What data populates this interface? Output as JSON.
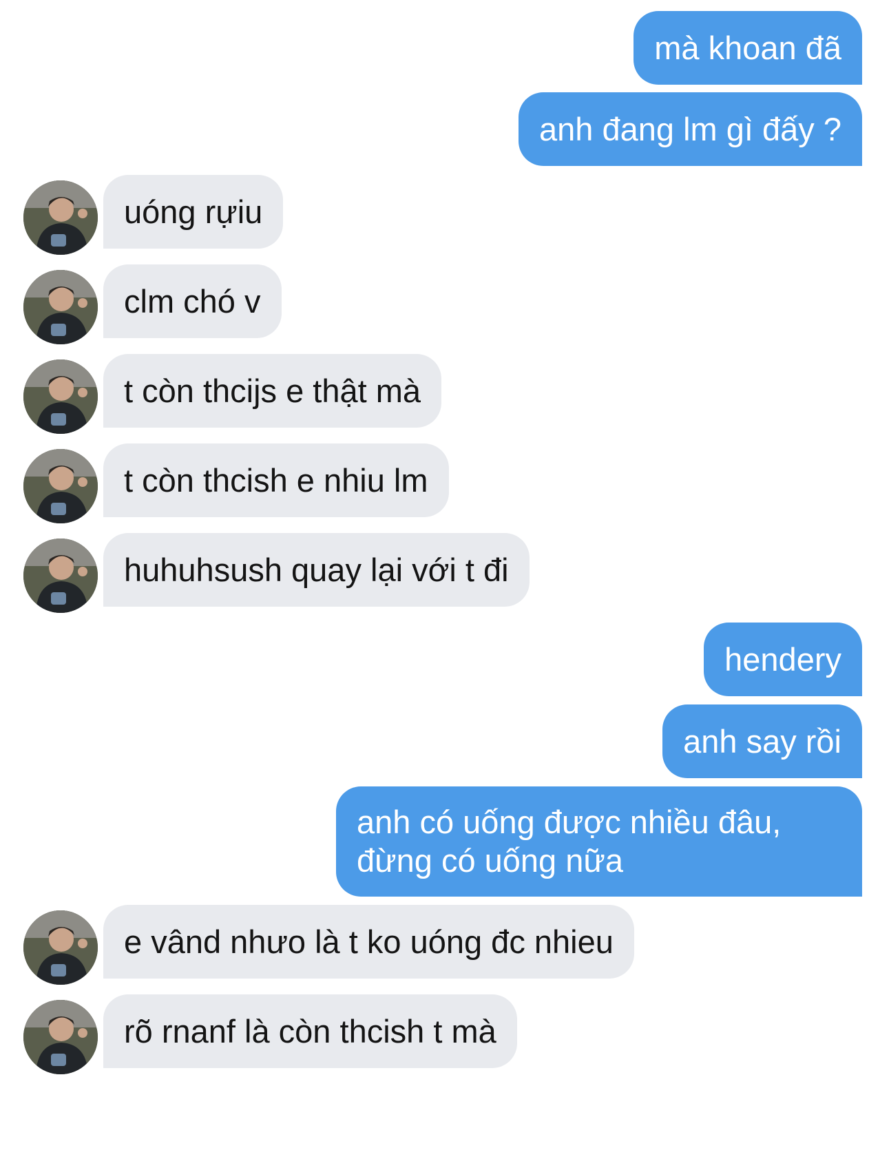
{
  "colors": {
    "sent_bubble": "#4c9be8",
    "received_bubble": "#e8eaee",
    "sent_text": "#ffffff",
    "received_text": "#141414"
  },
  "avatar": {
    "icon": "contact-avatar-photo"
  },
  "messages": [
    {
      "side": "sent",
      "text": "mà khoan đã"
    },
    {
      "side": "sent",
      "text": "anh đang lm gì đấy ?"
    },
    {
      "side": "received",
      "text": "uóng rựiu"
    },
    {
      "side": "received",
      "text": "clm chó v"
    },
    {
      "side": "received",
      "text": "t còn thcijs e thật mà"
    },
    {
      "side": "received",
      "text": "t còn thcish e nhiu lm"
    },
    {
      "side": "received",
      "text": "huhuhsush quay lại với t đi"
    },
    {
      "side": "sent",
      "text": "hendery"
    },
    {
      "side": "sent",
      "text": "anh say rồi"
    },
    {
      "side": "sent",
      "lines": [
        "anh có uống được nhiều đâu,",
        "đừng có uống nữa"
      ]
    },
    {
      "side": "received",
      "text": "e vând nhưo là t ko uóng đc nhieu"
    },
    {
      "side": "received",
      "text": "rõ rnanf là còn thcish t mà"
    }
  ]
}
